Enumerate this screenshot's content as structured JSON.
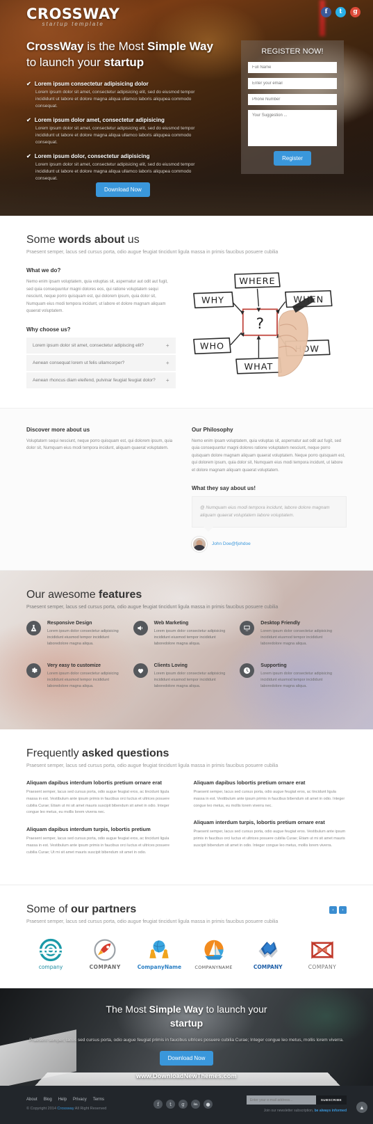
{
  "brand": {
    "logo_main": "CROSSWAY",
    "logo_sub": "startup  template"
  },
  "social_top": [
    {
      "name": "facebook",
      "glyph": "f",
      "color": "#3b5998"
    },
    {
      "name": "twitter",
      "glyph": "t",
      "color": "#29b0e8"
    },
    {
      "name": "google-plus",
      "glyph": "g",
      "color": "#dd4b39"
    }
  ],
  "hero": {
    "heading_1": "CrossWay",
    "heading_2": " is the Most ",
    "heading_3": "Simple Way",
    "heading_4": "to launch your ",
    "heading_5": "startup",
    "check": "✔",
    "items": [
      {
        "title": "Lorem ipsum consectetur adipisicing dolor",
        "text": "Lorem ipsum dolor sit amet, consectetur adipisicing elit, sed do eiusmod tempor incididunt ut labore et dolore magna aliqua ullamco laboris aliqupea commodo consequat."
      },
      {
        "title": "Lorem ipsum dolor amet, consectetur adipisicing",
        "text": "Lorem ipsum dolor sit amet, consectetur adipisicing elit, sed do eiusmod tempor incididunt ut labore et dolore magna aliqua ullamco laboris aliqupea commodo consequat."
      },
      {
        "title": "Lorem ipsum dolor, consectetur adipisicing",
        "text": "Lorem ipsum dolor sit amet, consectetur adipisicing elit, sed do eiusmod tempor incididunt ut labore et dolore magna aliqua ullamco laboris aliqupea commodo consequat."
      }
    ],
    "download_label": "Download Now"
  },
  "register": {
    "title": "REGISTER NOW!",
    "name_placeholder": "Full Name",
    "email_placeholder": "Enter your email",
    "phone_placeholder": "Phone Number",
    "suggestion_placeholder": "Your Suggestion ...",
    "submit_label": "Register"
  },
  "about": {
    "title_1": "Some ",
    "title_2": "words about",
    "title_3": " us",
    "subtitle": "Praesent semper, lacus sed cursus porta, odio augue feugiat tincidunt ligula massa in primis faucibus posuere cubilia",
    "what_we_do_heading": "What we do?",
    "what_we_do_text": "Nemo enim ipsam voluptatem, quia voluptas sit, aspernatur aut odit aut fugit, sed quia consequuntur magni dolores eos, qui ratione voluptatem sequi nesciunt, neque porro quisquam est, qui dolorem ipsum, quia dolor sit, Numquam eius modi tempora incidunt, ut labore et dolore magnam aliquam quaerat voluptatem.",
    "why_choose_heading": "Why choose us?",
    "accordion": [
      {
        "question": "Lorem ipsum dolor sit amet, consectetur adipiscing elit?",
        "toggle": "+"
      },
      {
        "question": "Aenean consequat lorem ut felis ullamcorper?",
        "toggle": "+"
      },
      {
        "question": "Aenean rhoncus diam eleifend, pulvinar feugiat feugiat dolor?",
        "toggle": "+"
      }
    ],
    "diagram": {
      "center": "?",
      "boxes": [
        "WHERE",
        "WHY",
        "WHEN",
        "WHO",
        "HOW",
        "WHAT"
      ]
    }
  },
  "discover": {
    "left_heading": "Discover more about us",
    "left_text": "Voluptatem sequi nesciunt, neque porro quisquam est, qui dolorem ipsum, quia dolor sit, Numquam eius modi tempora incidunt, aliquam quaerat voluptatem.",
    "right_heading": "Our Philosophy",
    "right_text": "Nemo enim ipsam voluptatem, quia voluptas sit, aspernatur aut odit aut fugit, sed quia consequuntur magni dolores ratione voluptatem nesciunt, neque porro quisquam dolore magnam aliquam quaerat voluptatem. Neque porro quisquam est, qui dolorem ipsum, quia dolor sit, Numquam eius modi tempora incidunt, ut labore et dolore magnam aliquam quaerat voluptatem.",
    "testimonial_heading": "What they say about us!",
    "testimonial_quote": "@ Numquam eius modi tempora incidunt, labore dolore magnam aliquam quaerat voluptatem labore voluptatem.",
    "testimonial_author": "John Doe@fjohdoe"
  },
  "features": {
    "title_1": "Our awesome ",
    "title_2": "features",
    "subtitle": "Praesent semper, lacus sed cursus porta, odio augue feugiat tincidunt ligula massa in primis faucibus posuere cubilia",
    "body": "Lorem ipsum dolor consectetur adipisicing incididunt eiusmod tempor incididunt laboredolore magna aliqua.",
    "items": [
      {
        "title": "Responsive Design",
        "icon": "flask-icon"
      },
      {
        "title": "Web Marketing",
        "icon": "megaphone-icon"
      },
      {
        "title": "Desktop Friendly",
        "icon": "monitor-icon"
      },
      {
        "title": "Very easy to customize",
        "icon": "gear-icon"
      },
      {
        "title": "Clients Loving",
        "icon": "heart-icon"
      },
      {
        "title": "Supporting",
        "icon": "clock-icon"
      }
    ]
  },
  "faq": {
    "title_1": "Frequently ",
    "title_2": "asked questions",
    "subtitle": "Praesent semper, lacus sed cursus porta, odio augue feugiat tincidunt ligula massa in primis faucibus posuere cubilia",
    "left": [
      {
        "q": "Aliquam dapibus interdum lobortis pretium ornare erat",
        "a": "Praesent semper, lacus sed cursus porta, odio augue feugiat eros, ac tincidunt ligula massa in est. Vestibulum ante ipsum primis in faucibus orci luctus et ultrices posuere cubilia Curae; Etiam ut mi sit amet mauris suscipit bibendum sit amet in odio. Integer congue leo metus, eu mollis lorem viverra nec."
      },
      {
        "q": "Aliquam dapibus interdum turpis, lobortis pretium",
        "a": "Praesent semper, lacus sed cursus porta, odio augue feugiat eros, ac tincidunt ligula massa in est. Vestibulum ante ipsum primis in faucibus orci luctus et ultrices posuere cubilia Curae; Ut mi sit amet mauris suscipit bibendum sit amet in odio."
      }
    ],
    "right": [
      {
        "q": "Aliquam dapibus lobortis pretium ornare erat",
        "a": "Praesent semper, lacus sed cursus porta, odio augue feugiat eros, ac tincidunt ligula massa in est. Vestibulum ante ipsum primis in faucibus bibendum sit amet in odio. Integer congue leo metus, eu mollis lorem viverra nec."
      },
      {
        "q": "Aliquam interdum turpis, lobortis pretium ornare erat",
        "a": "Praesent semper, lacus sed cursus porta, odio augue feugiat eros. Vestibulum ante ipsum primis in faucibus orci luctus et ultrices posuere cubilia Curae; Etiam ut mi sit amet mauris suscipit bibendum sit amet in odio. Integer congue leo metus, mollis lorem viverra."
      }
    ]
  },
  "partners": {
    "title_1": "Some of ",
    "title_2": "our partners",
    "subtitle": "Praesent semper, lacus sed cursus porta, odio augue feugiat tincidunt ligula massa in primis faucibus posuere cubilia",
    "prev": "‹",
    "next": "›",
    "logos": [
      {
        "name": "company",
        "color": "#1b8ba0"
      },
      {
        "name": "COMPANY",
        "color": "#6b6b6b"
      },
      {
        "name": "CompanyName",
        "color": "#2a7fc4"
      },
      {
        "name": "COMPANYNAME",
        "color": "#555555"
      },
      {
        "name": "COMPANY",
        "color": "#1e5fa8"
      },
      {
        "name": "COMPANY",
        "color": "#777777"
      }
    ]
  },
  "cta": {
    "heading_1": "The Most ",
    "heading_2": "Simple Way",
    "heading_3": " to launch your",
    "heading_4": "startup",
    "text": "Praesent semper, lacus sed cursus porta, odio augue feugiat primis in faucibus ultrices posuere cubilia Curae; Integer congue leo metus, mollis lorem viverra.",
    "button_label": "Download Now",
    "url": "www.DownloadNewThemes.com"
  },
  "footer": {
    "links": [
      "About",
      "Blog",
      "Help",
      "Privacy",
      "Terms"
    ],
    "copyright_pre": "© Copyright 2014 ",
    "copyright_brand": "Crossway",
    "copyright_post": " All Right Reserved",
    "social": [
      {
        "name": "facebook",
        "glyph": "f"
      },
      {
        "name": "twitter",
        "glyph": "t"
      },
      {
        "name": "google-plus",
        "glyph": "g"
      },
      {
        "name": "linkedin",
        "glyph": "in"
      },
      {
        "name": "dribbble",
        "glyph": "●"
      }
    ],
    "newsletter_placeholder": "Enter your e-mail address...",
    "subscribe_label": "SUBSCRIBE",
    "note_pre": "Join our newsletter subscription, ",
    "note_strong": "be always informed",
    "to_top": "▲"
  }
}
